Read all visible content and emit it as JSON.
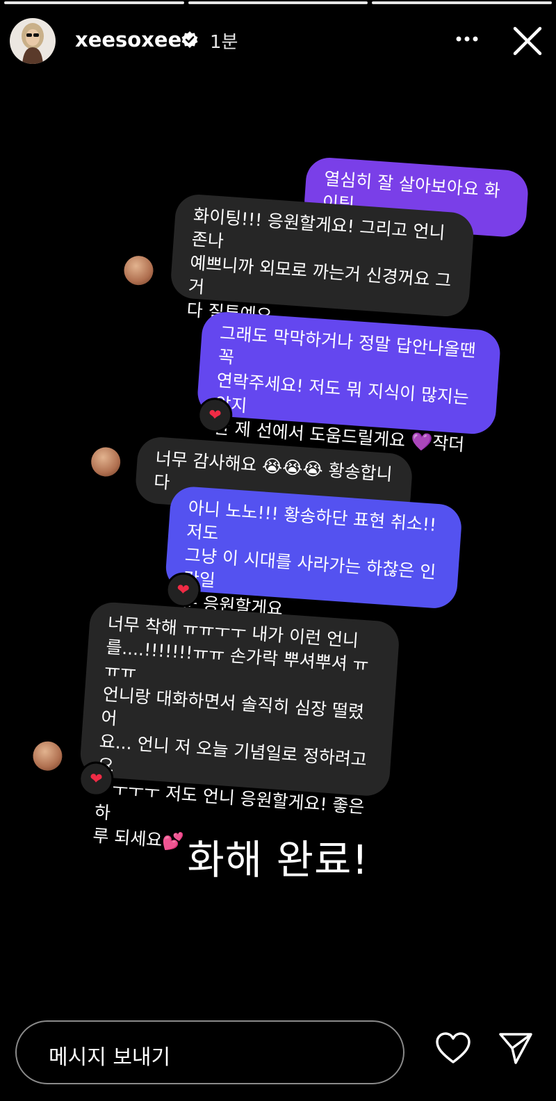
{
  "progress": [
    1,
    1,
    1
  ],
  "header": {
    "username": "xeesoxee",
    "time": "1분"
  },
  "messages": [
    {
      "id": "m1",
      "text": "열심히 잘 살아보아요 화이팅"
    },
    {
      "id": "m2",
      "text": "화이팅!!! 응원할게요! 그리고 언니 존나\n예쁘니까 외모로 까는거 신경꺼요 그거\n다 질투예요"
    },
    {
      "id": "m3",
      "text": "그래도 막막하거나 정말 답안나올땐 꼭\n연락주세요! 저도 뭐 지식이 많지는 않지\n만 제 선에서 도움드릴게요 💜작더라도"
    },
    {
      "id": "m4",
      "text": "너무 감사해요 😭😭😭 황송합니다"
    },
    {
      "id": "m5",
      "text": "아니 노노!!! 황송하단 표현 취소!! 저도\n그냥 이 시대를 사라가는 하찮은 인간일\n뿐 응원할게요"
    },
    {
      "id": "m6",
      "text": "너무 착해 ㅠㅠㅜㅜ 내가 이런 언니\n를....!!!!!!!ㅠㅠ 손가락 뿌셔뿌셔 ㅠㅠㅠ\n언니랑 대화하면서 솔직히 심장 떨렸어\n요... 언니 저 오늘 기념일로 정하려고요\nㅜㅜㅜㅜ 저도 언니 응원할게요! 좋은 하\n루 되세요💕"
    }
  ],
  "reaction": "❤",
  "caption": "화해 완료!",
  "footer": {
    "message_placeholder": "메시지 보내기"
  },
  "colors": {
    "background": "#000000",
    "bubble_purple": "#7a3fe8",
    "bubble_violet": "#6447ef",
    "bubble_blue": "#5452f0",
    "bubble_gray": "#262626",
    "heart_red": "#ef2b45"
  },
  "icons": [
    "verified-badge-icon",
    "more-options-icon",
    "close-icon",
    "heart-icon",
    "send-icon"
  ]
}
